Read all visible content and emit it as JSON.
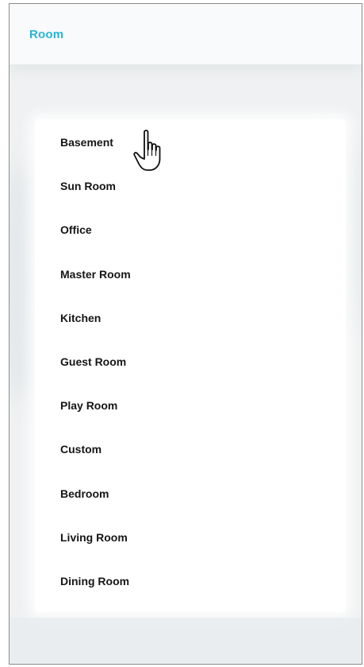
{
  "header": {
    "title": "Room"
  },
  "rooms": [
    {
      "label": "Basement"
    },
    {
      "label": "Sun Room"
    },
    {
      "label": "Office"
    },
    {
      "label": "Master Room"
    },
    {
      "label": "Kitchen"
    },
    {
      "label": "Guest Room"
    },
    {
      "label": "Play Room"
    },
    {
      "label": "Custom"
    },
    {
      "label": "Bedroom"
    },
    {
      "label": "Living Room"
    },
    {
      "label": "Dining Room"
    }
  ],
  "cursor": {
    "icon": "pointer-hand-icon",
    "hovered_item": "Basement"
  },
  "colors": {
    "accent": "#27b5d6",
    "item_text": "#161616",
    "background": "#eff1f2",
    "card": "#ffffff"
  }
}
